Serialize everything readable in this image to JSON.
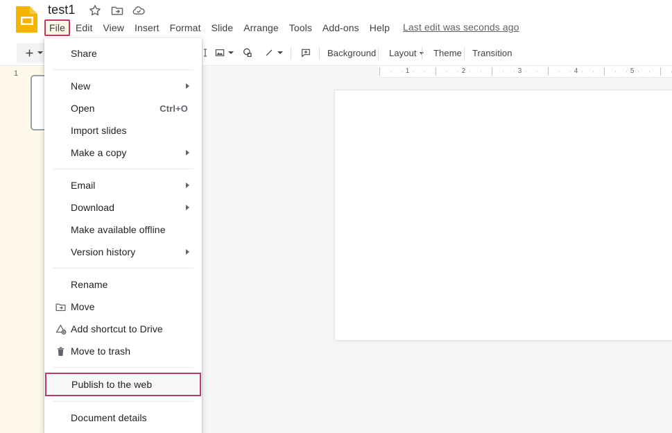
{
  "app": {
    "logo_icon": "slides-logo-icon",
    "document_title": "test1",
    "title_icons": [
      {
        "name": "star-icon",
        "label": "Star"
      },
      {
        "name": "move-to-folder-icon",
        "label": "Move to folder"
      },
      {
        "name": "cloud-status-icon",
        "label": "See document status"
      }
    ]
  },
  "menubar": {
    "items": [
      {
        "label": "File",
        "active": true
      },
      {
        "label": "Edit",
        "active": false
      },
      {
        "label": "View",
        "active": false
      },
      {
        "label": "Insert",
        "active": false
      },
      {
        "label": "Format",
        "active": false
      },
      {
        "label": "Slide",
        "active": false
      },
      {
        "label": "Arrange",
        "active": false
      },
      {
        "label": "Tools",
        "active": false
      },
      {
        "label": "Add-ons",
        "active": false
      },
      {
        "label": "Help",
        "active": false
      }
    ],
    "last_edit": "Last edit was seconds ago"
  },
  "toolbar": {
    "new_slide_label": "+",
    "icons": [
      {
        "name": "text-box-icon"
      },
      {
        "name": "insert-image-icon"
      },
      {
        "name": "insert-shape-icon"
      },
      {
        "name": "insert-line-icon"
      },
      {
        "name": "add-comment-icon"
      }
    ],
    "background_label": "Background",
    "layout_label": "Layout",
    "theme_label": "Theme",
    "transition_label": "Transition"
  },
  "filmstrip": {
    "slide_number": "1"
  },
  "ruler": {
    "labels": [
      "1",
      "2",
      "3",
      "4",
      "5"
    ]
  },
  "file_menu": {
    "highlight_color": "#c2376a",
    "sections": [
      {
        "items": [
          {
            "label": "Share",
            "icon": null,
            "accel": null,
            "submenu": false,
            "highlighted": false
          }
        ]
      },
      {
        "items": [
          {
            "label": "New",
            "icon": null,
            "accel": null,
            "submenu": true,
            "highlighted": false
          },
          {
            "label": "Open",
            "icon": null,
            "accel": "Ctrl+O",
            "submenu": false,
            "highlighted": false
          },
          {
            "label": "Import slides",
            "icon": null,
            "accel": null,
            "submenu": false,
            "highlighted": false
          },
          {
            "label": "Make a copy",
            "icon": null,
            "accel": null,
            "submenu": true,
            "highlighted": false
          }
        ]
      },
      {
        "items": [
          {
            "label": "Email",
            "icon": null,
            "accel": null,
            "submenu": true,
            "highlighted": false
          },
          {
            "label": "Download",
            "icon": null,
            "accel": null,
            "submenu": true,
            "highlighted": false
          },
          {
            "label": "Make available offline",
            "icon": null,
            "accel": null,
            "submenu": false,
            "highlighted": false
          },
          {
            "label": "Version history",
            "icon": null,
            "accel": null,
            "submenu": true,
            "highlighted": false
          }
        ]
      },
      {
        "items": [
          {
            "label": "Rename",
            "icon": null,
            "accel": null,
            "submenu": false,
            "highlighted": false
          },
          {
            "label": "Move",
            "icon": "move-to-folder-icon",
            "accel": null,
            "submenu": false,
            "highlighted": false
          },
          {
            "label": "Add shortcut to Drive",
            "icon": "add-shortcut-drive-icon",
            "accel": null,
            "submenu": false,
            "highlighted": false
          },
          {
            "label": "Move to trash",
            "icon": "trash-icon",
            "accel": null,
            "submenu": false,
            "highlighted": false
          }
        ]
      },
      {
        "items": [
          {
            "label": "Publish to the web",
            "icon": null,
            "accel": null,
            "submenu": false,
            "highlighted": true
          }
        ]
      },
      {
        "items": [
          {
            "label": "Document details",
            "icon": null,
            "accel": null,
            "submenu": false,
            "highlighted": false
          }
        ]
      }
    ]
  }
}
